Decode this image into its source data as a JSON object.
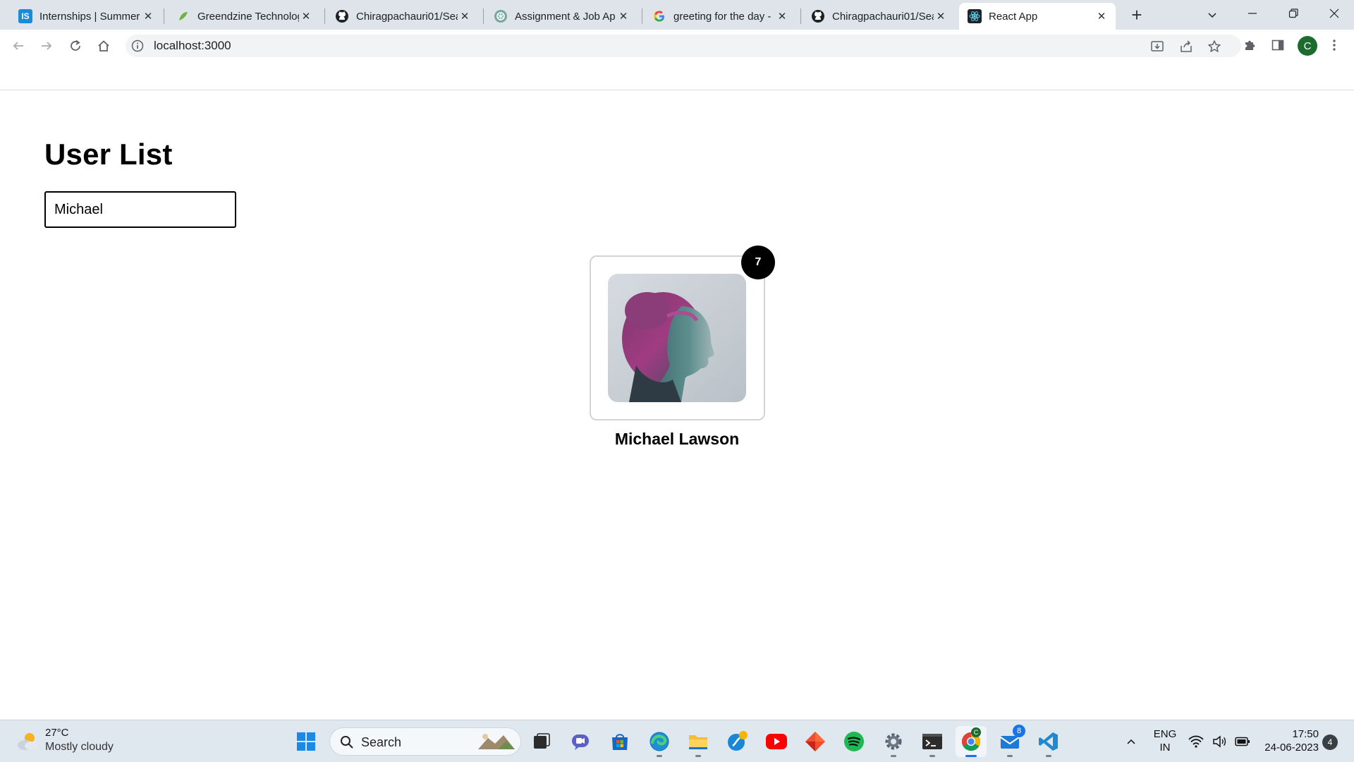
{
  "browser": {
    "tabs": [
      {
        "title": "Internships | Summer",
        "favicon": "internshala-icon",
        "active": false
      },
      {
        "title": "Greendzine Technolog",
        "favicon": "greendzine-icon",
        "active": false
      },
      {
        "title": "Chiragpachauri01/Sea",
        "favicon": "github-icon",
        "active": false
      },
      {
        "title": "Assignment & Job Ap",
        "favicon": "chatgpt-icon",
        "active": false
      },
      {
        "title": "greeting for the day -",
        "favicon": "google-icon",
        "active": false
      },
      {
        "title": "Chiragpachauri01/Sea",
        "favicon": "github-icon",
        "active": false
      },
      {
        "title": "React App",
        "favicon": "react-icon",
        "active": true
      }
    ],
    "new_tab_label": "+",
    "address_bar": {
      "url": "localhost:3000"
    },
    "profile_initial": "C"
  },
  "page": {
    "heading": "User List",
    "search": {
      "value": "Michael",
      "placeholder": ""
    },
    "users": [
      {
        "name": "Michael Lawson",
        "badge": "7"
      }
    ]
  },
  "taskbar": {
    "weather": {
      "temp": "27°C",
      "condition": "Mostly cloudy"
    },
    "search_label": "Search",
    "apps": [
      "windows-start-icon",
      "search",
      "task-view-icon",
      "teams-chat-icon",
      "microsoft-store-icon",
      "edge-icon",
      "file-explorer-icon",
      "unknown-app-icon",
      "youtube-icon",
      "git-icon",
      "spotify-icon",
      "settings-icon",
      "terminal-icon",
      "chrome-icon",
      "mail-icon",
      "vscode-icon"
    ],
    "mail_badge": "8",
    "lang_line1": "ENG",
    "lang_line2": "IN",
    "time": "17:50",
    "date": "24-06-2023",
    "notification_count": "4"
  },
  "colors": {
    "tabstrip": "#dfe3ea",
    "badge": "#000000",
    "taskbar": "#dfe7ef",
    "accent": "#1a73e8"
  }
}
